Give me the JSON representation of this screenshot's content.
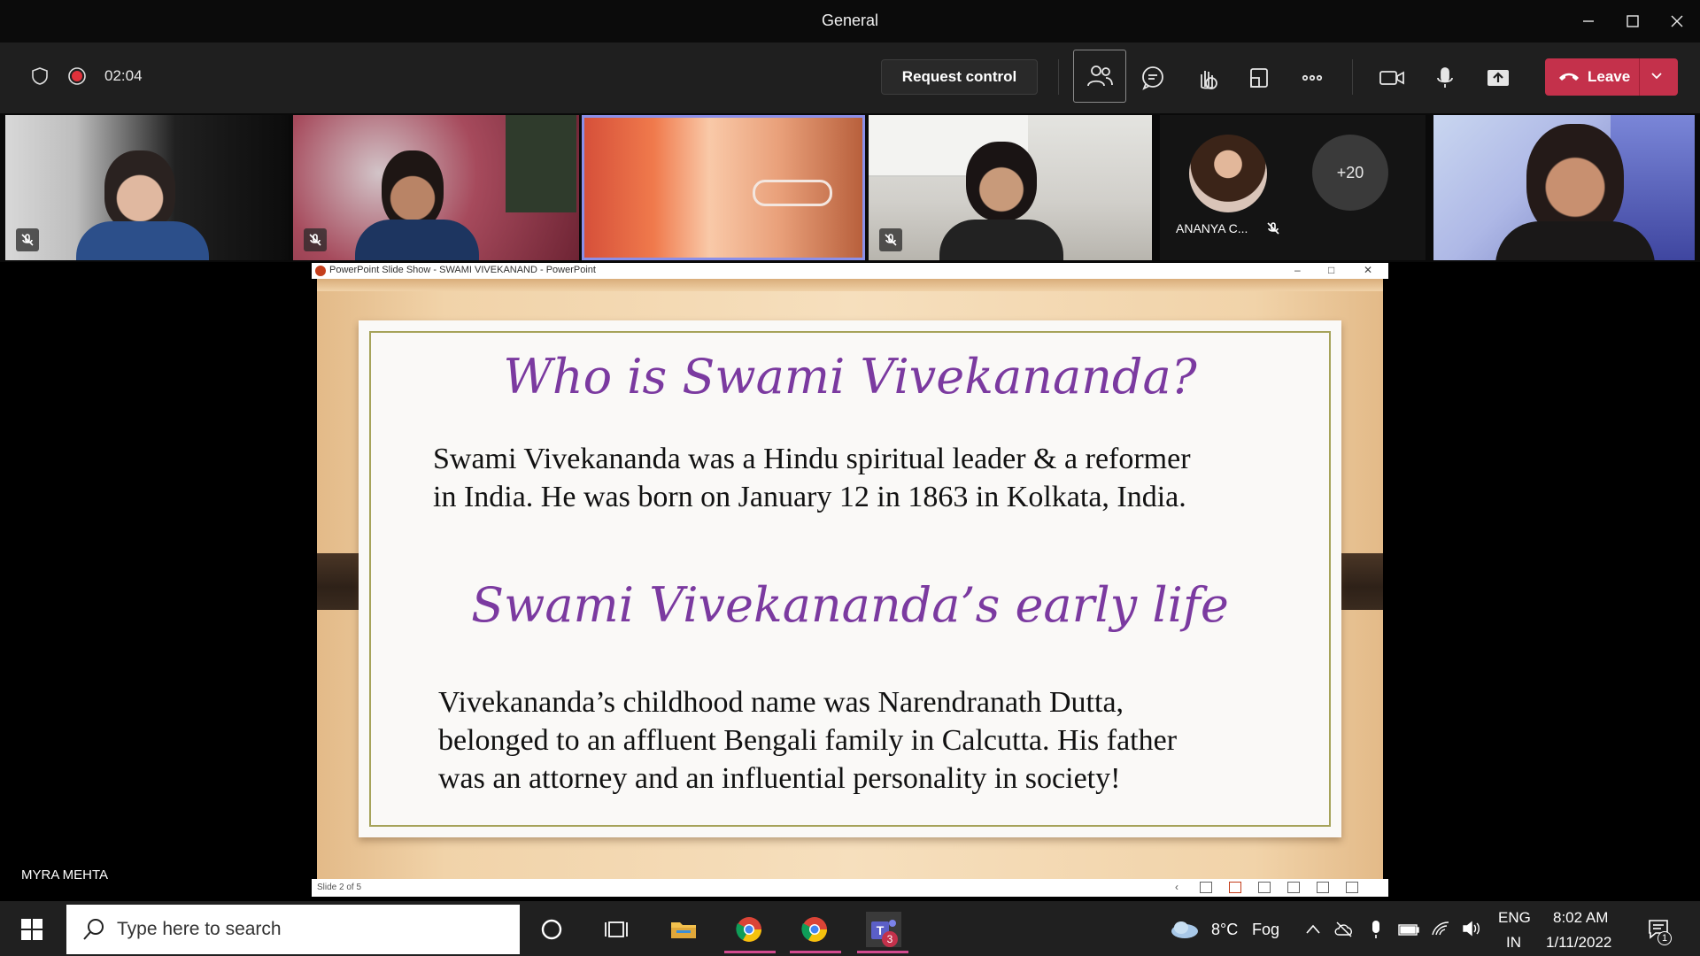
{
  "window": {
    "title": "General"
  },
  "meeting": {
    "timer": "02:04",
    "request_control_label": "Request control",
    "leave_label": "Leave"
  },
  "participants": {
    "named_tile": "ANANYA C...",
    "overflow_count": "+20",
    "presenter_name": "MYRA MEHTA"
  },
  "ppt": {
    "window_title": "PowerPoint Slide Show  -  SWAMI VIVEKANAND - PowerPoint",
    "status": "Slide 2 of 5",
    "heading1": "Who is Swami Vivekananda?",
    "para1_line1": "Swami Vivekananda was a Hindu spiritual leader & a reformer",
    "para1_line2": "in India. He was born on January 12 in 1863 in Kolkata, India.",
    "heading2": "Swami Vivekananda’s early life",
    "para2_line1": "Vivekananda’s childhood name was Narendranath Dutta,",
    "para2_line2": "belonged to an affluent Bengali family in Calcutta. His father",
    "para2_line3": "was an attorney and an influential personality in society!"
  },
  "taskbar": {
    "search_placeholder": "Type here to search",
    "weather_temp": "8°C",
    "weather_desc": "Fog",
    "language": "ENG",
    "region": "IN",
    "time": "8:02 AM",
    "date": "1/11/2022",
    "teams_badge": "3",
    "notification_count": "1"
  },
  "colors": {
    "leave": "#c4314b",
    "slide_heading": "#7b3aa0",
    "toolbar_bg": "#1f1f1f"
  }
}
